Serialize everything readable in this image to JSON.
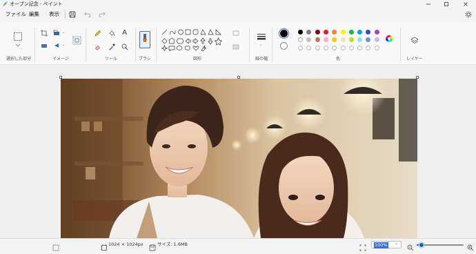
{
  "window": {
    "title": "オープン記念 - ペイント"
  },
  "menu": {
    "file": "ファイル",
    "edit": "編集",
    "view": "表示"
  },
  "ribbon": {
    "groups": {
      "selection": "選択した部分",
      "image": "イメージ",
      "tools": "ツール",
      "brushes": "ブラシ",
      "shapes": "図形",
      "stroke_width": "線の幅",
      "colors": "色",
      "layers": "レイヤー"
    }
  },
  "colors": {
    "primary": "#000000",
    "secondary": "#ffffff",
    "accent": "#0067c0",
    "palette_row1": [
      "#000000",
      "#7f7f7f",
      "#880015",
      "#ed1c24",
      "#ff7f27",
      "#fff200",
      "#22b14c",
      "#00a2e8",
      "#3f48cc",
      "#a349a4"
    ],
    "palette_row2": [
      "#ffffff",
      "#c3c3c3",
      "#b97a57",
      "#ffaec9",
      "#ffc90e",
      "#efe4b0",
      "#b5e61d",
      "#99d9ea",
      "#7092be",
      "#c8bfe7"
    ]
  },
  "icons": {
    "undo": "undo-icon",
    "redo": "redo-icon",
    "save": "save-icon",
    "settings": "gear-icon",
    "zoom_out": "zoom-out-icon",
    "zoom_in": "zoom-in-icon"
  },
  "status": {
    "dimensions": "1024 × 1024px",
    "size": "サイズ: 1.6MB",
    "zoom": "100%",
    "zoom_level": 0.1
  }
}
